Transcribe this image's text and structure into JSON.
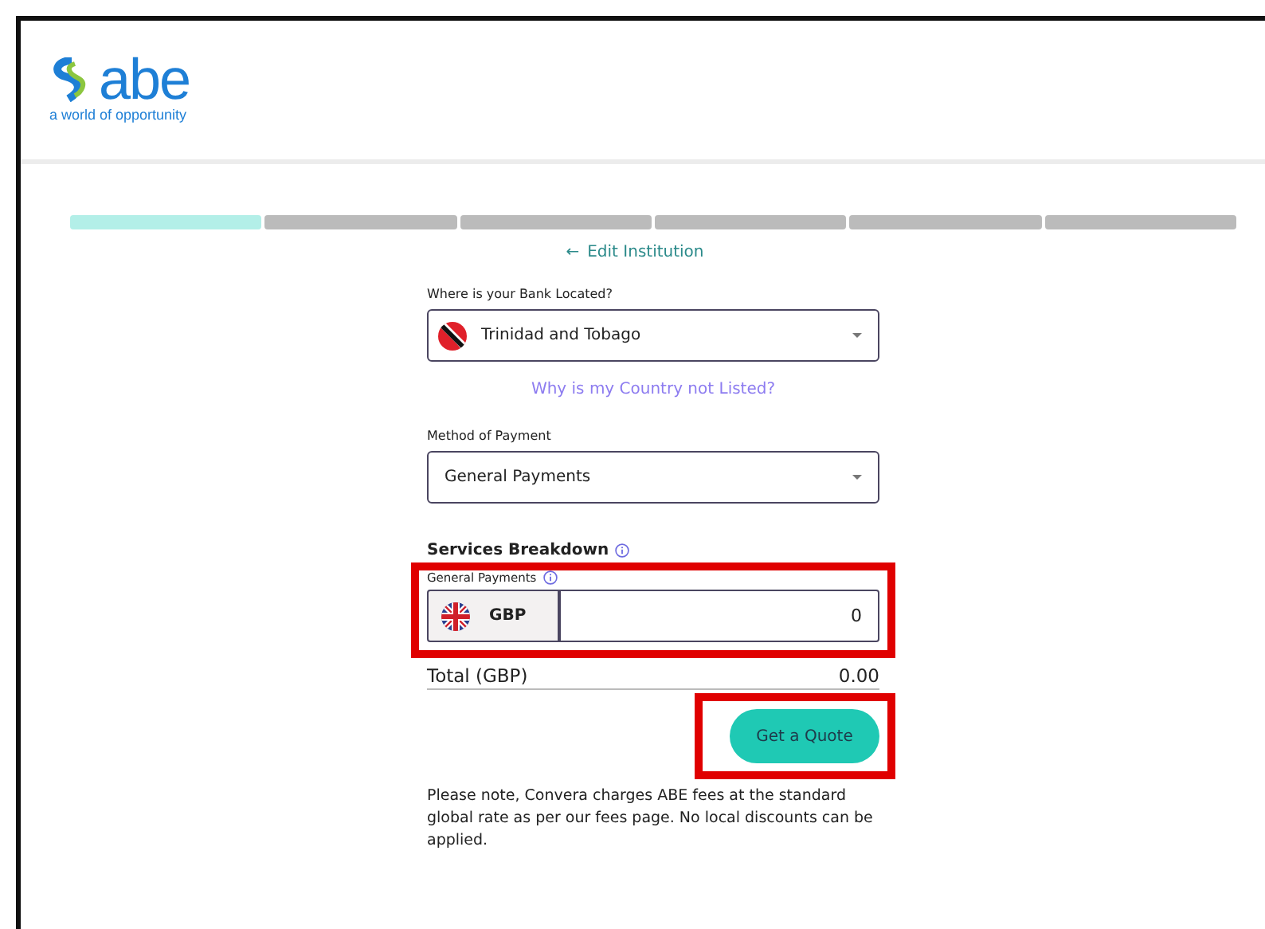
{
  "logo": {
    "wordmark": "abe",
    "tagline": "a world of opportunity"
  },
  "steps": [
    {
      "completed": true
    },
    {
      "completed": false
    },
    {
      "completed": false
    },
    {
      "completed": false
    },
    {
      "completed": false
    },
    {
      "completed": false
    }
  ],
  "back_link": {
    "icon": "←",
    "label": "Edit Institution"
  },
  "bank_location": {
    "label": "Where is your Bank Located?",
    "value": "Trinidad and Tobago"
  },
  "country_link": "Why is my Country not Listed?",
  "payment_method": {
    "label": "Method of Payment",
    "value": "General Payments"
  },
  "services": {
    "title": "Services Breakdown",
    "highlighted": true,
    "item_label": "General Payments",
    "currency": "GBP",
    "amount": "0"
  },
  "total": {
    "label": "Total (GBP)",
    "value": "0.00"
  },
  "quote_button": {
    "label": "Get a Quote",
    "highlighted": true
  },
  "note": "Please note, Convera charges ABE fees at the standard global rate as per our fees page. No local discounts can be applied."
}
